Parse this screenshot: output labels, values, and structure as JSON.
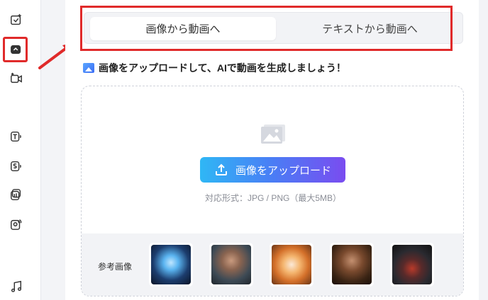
{
  "sidebar": {
    "icons": [
      {
        "name": "image-plus-icon"
      },
      {
        "name": "image-to-video-icon"
      },
      {
        "name": "video-plus-icon"
      },
      {
        "name": "text-speech-icon"
      },
      {
        "name": "sound-speech-icon"
      },
      {
        "name": "layers-audio-icon"
      },
      {
        "name": "portrait-audio-icon"
      },
      {
        "name": "music-icon"
      }
    ]
  },
  "tabs": {
    "active": "画像から動画へ",
    "inactive": "テキストから動画へ"
  },
  "headline": "画像をアップロードして、AIで動画を生成しましょう！",
  "upload": {
    "button_label": "画像をアップロード",
    "formats": "対応形式：JPG / PNG（最大5MB）"
  },
  "reference": {
    "label": "参考画像"
  },
  "colors": {
    "highlight": "#e02a2a",
    "gradient_start": "#2fb7f5",
    "gradient_end": "#7a4cf0"
  }
}
